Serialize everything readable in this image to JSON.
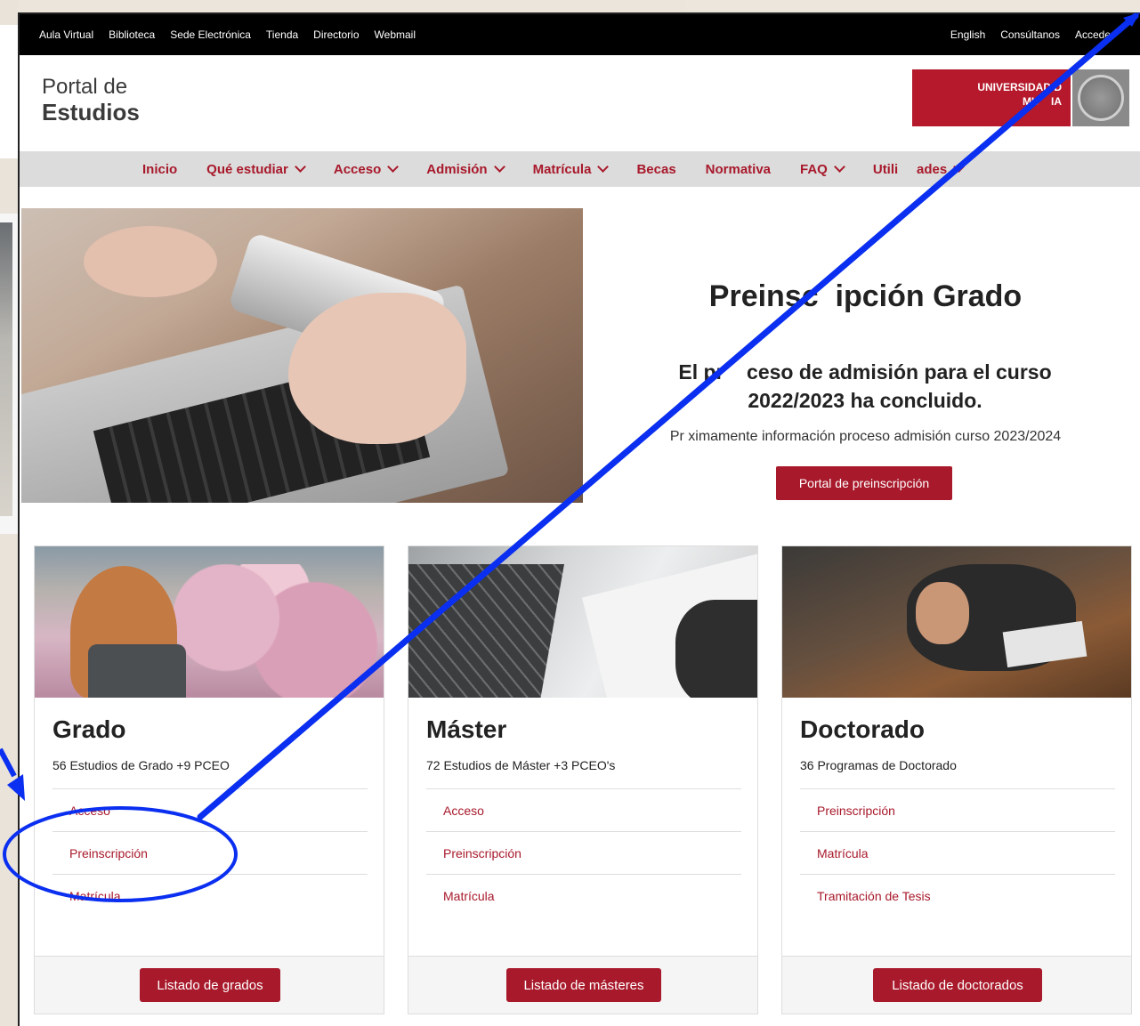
{
  "topbar": {
    "left_links": [
      "Aula Virtual",
      "Biblioteca",
      "Sede Electrónica",
      "Tienda",
      "Directorio",
      "Webmail"
    ],
    "right_links": [
      "English",
      "Consúltanos",
      "Acceder"
    ]
  },
  "header": {
    "logo_line1": "Portal de",
    "logo_line2": "Estudios",
    "univ_line1": "UNIVERSIDAD D",
    "univ_line2": "MU    IA"
  },
  "nav": {
    "items": [
      {
        "label": "Inicio"
      },
      {
        "label": "Qué estudiar"
      },
      {
        "label": "Acceso"
      },
      {
        "label": "Admisión"
      },
      {
        "label": "Matrícula"
      },
      {
        "label": "Becas"
      },
      {
        "label": "Normativa"
      },
      {
        "label": "FAQ"
      },
      {
        "label": "Utili     ades"
      }
    ]
  },
  "hero": {
    "title": "Preinsc  ipción Grado",
    "subtitle": "El pr    ceso de admisión para el curso 2022/2023 ha concluido.",
    "info": "Pr ximamente información proceso admisión curso 2023/2024",
    "button": "Portal de preinscripción"
  },
  "cards": [
    {
      "title": "Grado",
      "count": "56 Estudios de Grado +9 PCEO",
      "links": [
        "Acceso",
        "Preinscripción",
        "Matrícula"
      ],
      "footer_button": "Listado de grados"
    },
    {
      "title": "Máster",
      "count": "72 Estudios de Máster +3 PCEO's",
      "links": [
        "Acceso",
        "Preinscripción",
        "Matrícula"
      ],
      "footer_button": "Listado de másteres"
    },
    {
      "title": "Doctorado",
      "count": "36 Programas de Doctorado",
      "links": [
        "Preinscripción",
        "Matrícula",
        "Tramitación de Tesis"
      ],
      "footer_button": "Listado de doctorados"
    }
  ],
  "annotation": {
    "color": "#0a2ff0",
    "icon": "arrow-annotation-icon"
  },
  "colors": {
    "brand": "#a8192b",
    "topbar": "#000000",
    "navbar": "#dcdcdc"
  }
}
